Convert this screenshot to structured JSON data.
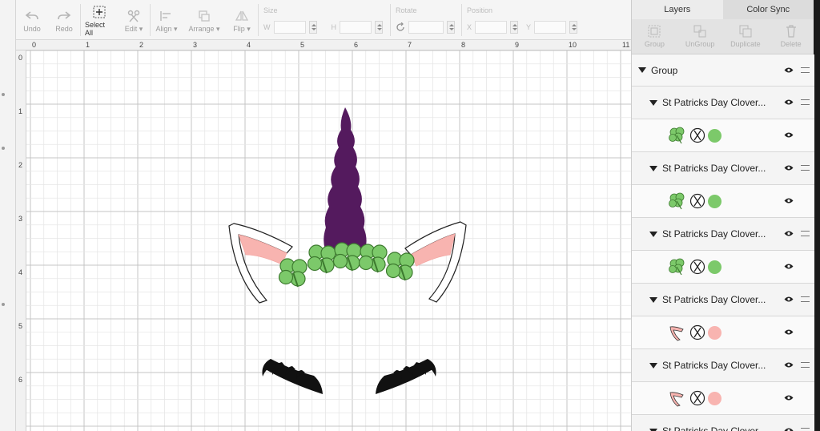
{
  "toolbar": {
    "undo": "Undo",
    "redo": "Redo",
    "select_all": "Select All",
    "edit": "Edit",
    "align": "Align",
    "arrange": "Arrange",
    "flip": "Flip",
    "size_label": "Size",
    "width_label": "W",
    "height_label": "H",
    "rotate_label": "Rotate",
    "position_label": "Position",
    "x_label": "X",
    "y_label": "Y"
  },
  "canvas": {
    "ruler_top": [
      "0",
      "1",
      "2",
      "3",
      "4",
      "5",
      "6",
      "7",
      "8",
      "9",
      "10",
      "11"
    ],
    "ruler_left": [
      "0",
      "1",
      "2",
      "3",
      "4",
      "5",
      "6"
    ]
  },
  "panel": {
    "tabs": [
      "Layers",
      "Color Sync"
    ],
    "actions": [
      "Group",
      "UnGroup",
      "Duplicate",
      "Delete"
    ],
    "group_label": "Group",
    "layers": [
      {
        "name": "St Patricks Day Clover...",
        "kind": "clover",
        "color": "#7cc96a"
      },
      {
        "name": "St Patricks Day Clover...",
        "kind": "clover",
        "color": "#7cc96a"
      },
      {
        "name": "St Patricks Day Clover...",
        "kind": "clover",
        "color": "#7cc96a"
      },
      {
        "name": "St Patricks Day Clover...",
        "kind": "ear",
        "color": "#f8b4b0"
      },
      {
        "name": "St Patricks Day Clover...",
        "kind": "ear",
        "color": "#f8b4b0"
      },
      {
        "name": "St Patricks Day Clover...",
        "kind": "partial"
      }
    ]
  },
  "colors": {
    "horn": "#541a5e",
    "ear_inner": "#f8b4b0",
    "clover": "#7cc96a",
    "lash": "#111111"
  }
}
